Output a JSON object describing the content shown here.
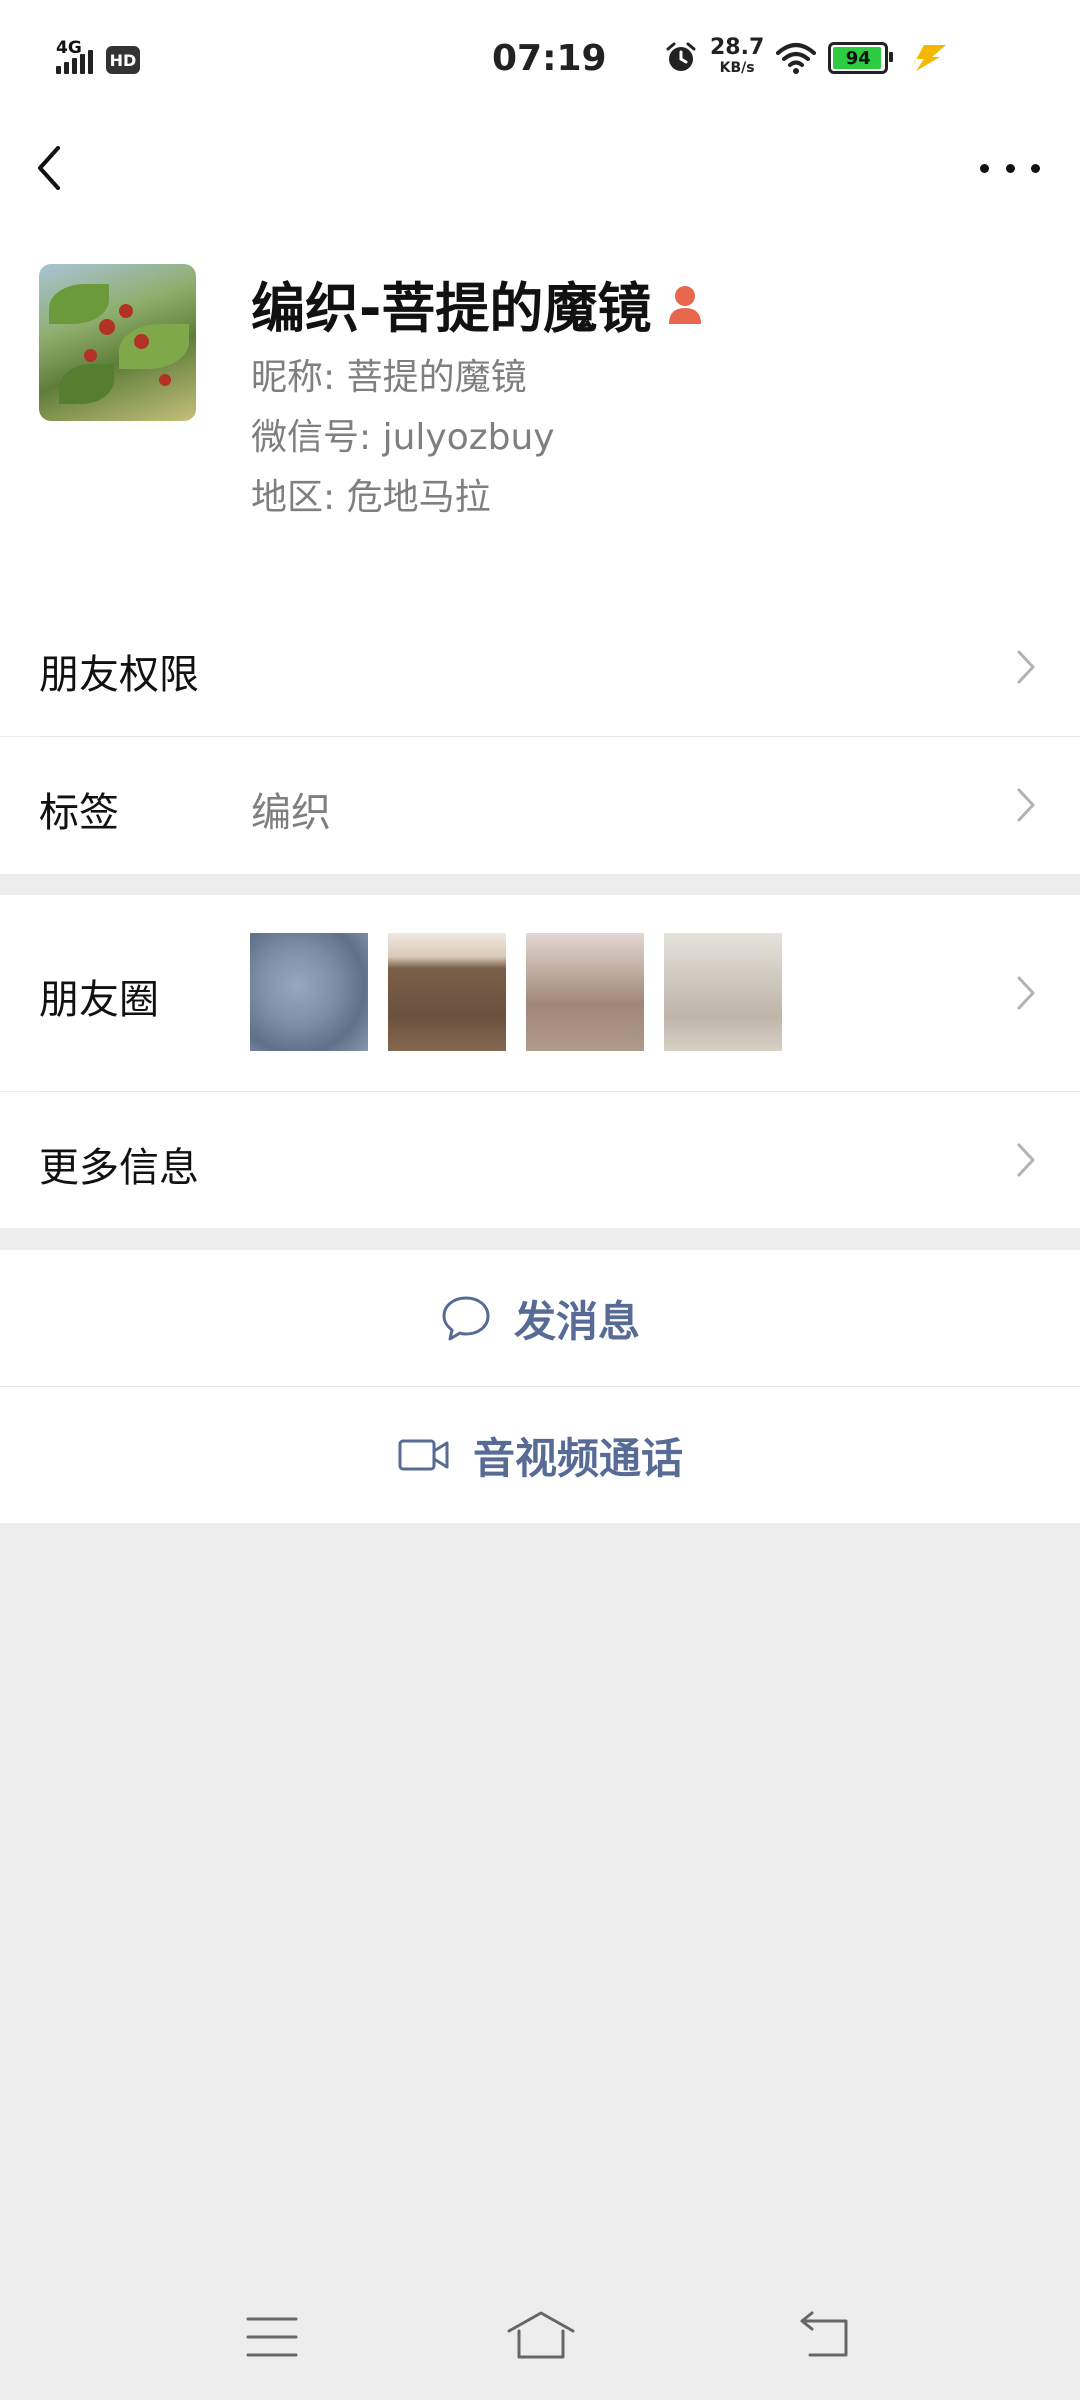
{
  "status_bar": {
    "network": "4G",
    "hd": "HD",
    "time": "07:19",
    "speed_value": "28.7",
    "speed_unit": "KB/s",
    "battery": "94"
  },
  "profile": {
    "name": "编织-菩提的魔镜",
    "nickname": "昵称: 菩提的魔镜",
    "wechat_id": "微信号: julyozbuy",
    "region": "地区: 危地马拉"
  },
  "rows": {
    "permissions": "朋友权限",
    "tags_label": "标签",
    "tags_value": "编织",
    "moments": "朋友圈",
    "more_info": "更多信息"
  },
  "actions": {
    "message": "发消息",
    "call": "音视频通话"
  },
  "colors": {
    "link": "#576b95",
    "background": "#ededed",
    "badge": "#e8674c"
  },
  "icons": {
    "back": "back-arrow-icon",
    "more": "more-dots-icon",
    "chevron": "chevron-right-icon",
    "message": "chat-bubble-icon",
    "call": "video-camera-icon"
  }
}
